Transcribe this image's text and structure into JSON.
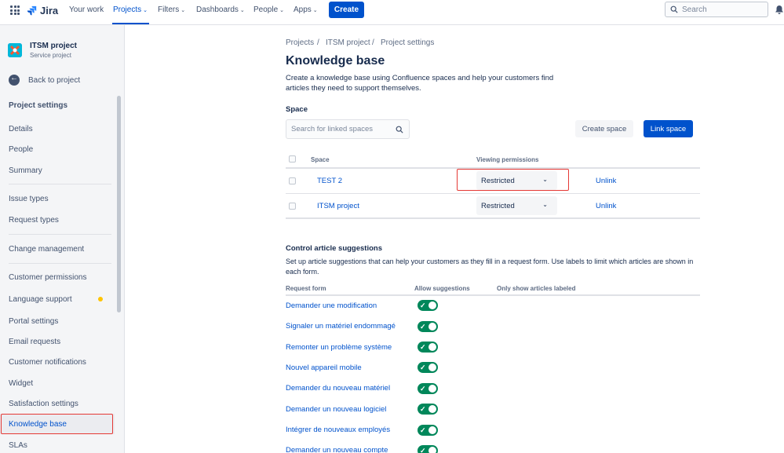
{
  "topnav": {
    "product": "Jira",
    "items": [
      {
        "label": "Your work",
        "dropdown": false
      },
      {
        "label": "Projects",
        "dropdown": true
      },
      {
        "label": "Filters",
        "dropdown": true
      },
      {
        "label": "Dashboards",
        "dropdown": true
      },
      {
        "label": "People",
        "dropdown": true
      },
      {
        "label": "Apps",
        "dropdown": true
      }
    ],
    "active": "Projects",
    "create_label": "Create",
    "search_placeholder": "Search"
  },
  "sidebar": {
    "project_name": "ITSM project",
    "project_type": "Service project",
    "back_label": "Back to project",
    "heading": "Project settings",
    "items": [
      {
        "label": "Details"
      },
      {
        "label": "People"
      },
      {
        "label": "Summary"
      },
      {
        "label": "Issue types"
      },
      {
        "label": "Request types"
      },
      {
        "label": "Change management"
      },
      {
        "label": "Customer permissions"
      },
      {
        "label": "Language support"
      },
      {
        "label": "Portal settings"
      },
      {
        "label": "Email requests"
      },
      {
        "label": "Customer notifications"
      },
      {
        "label": "Widget"
      },
      {
        "label": "Satisfaction settings"
      },
      {
        "label": "Knowledge base"
      },
      {
        "label": "SLAs"
      }
    ],
    "selected": "Knowledge base"
  },
  "breadcrumb": [
    "Projects",
    "ITSM project",
    "Project settings"
  ],
  "page": {
    "title": "Knowledge base",
    "description": "Create a knowledge base using Confluence spaces and help your customers find articles they need to support themselves."
  },
  "space_section": {
    "label": "Space",
    "search_placeholder": "Search for linked spaces",
    "create_space_label": "Create space",
    "link_space_label": "Link space",
    "columns": {
      "space": "Space",
      "viewing_permissions": "Viewing permissions"
    },
    "rows": [
      {
        "space": "TEST 2",
        "permission": "Restricted",
        "action": "Unlink"
      },
      {
        "space": "ITSM project",
        "permission": "Restricted",
        "action": "Unlink"
      }
    ]
  },
  "suggestions": {
    "title": "Control article suggestions",
    "description": "Set up article suggestions that can help your customers as they fill in a request form. Use labels to limit which articles are shown in each form.",
    "columns": {
      "request_form": "Request form",
      "allow": "Allow suggestions",
      "labeled": "Only show articles labeled"
    },
    "forms": [
      {
        "name": "Demander une modification",
        "allowed": true
      },
      {
        "name": "Signaler un matériel endommagé",
        "allowed": true
      },
      {
        "name": "Remonter un problème système",
        "allowed": true
      },
      {
        "name": "Nouvel appareil mobile",
        "allowed": true
      },
      {
        "name": "Demander du nouveau matériel",
        "allowed": true
      },
      {
        "name": "Demander un nouveau logiciel",
        "allowed": true
      },
      {
        "name": "Intégrer de nouveaux employés",
        "allowed": true
      },
      {
        "name": "Demander un nouveau compte",
        "allowed": true
      }
    ]
  },
  "colors": {
    "accent": "#0052cc",
    "toggle_on": "#00875a",
    "highlight": "#e53935",
    "badge": "#ffc400"
  },
  "icons": [
    "app-switcher-icon",
    "jira-logo-icon",
    "search-icon",
    "bell-icon",
    "back-arrow-icon",
    "chevron-down-icon",
    "check-icon"
  ]
}
